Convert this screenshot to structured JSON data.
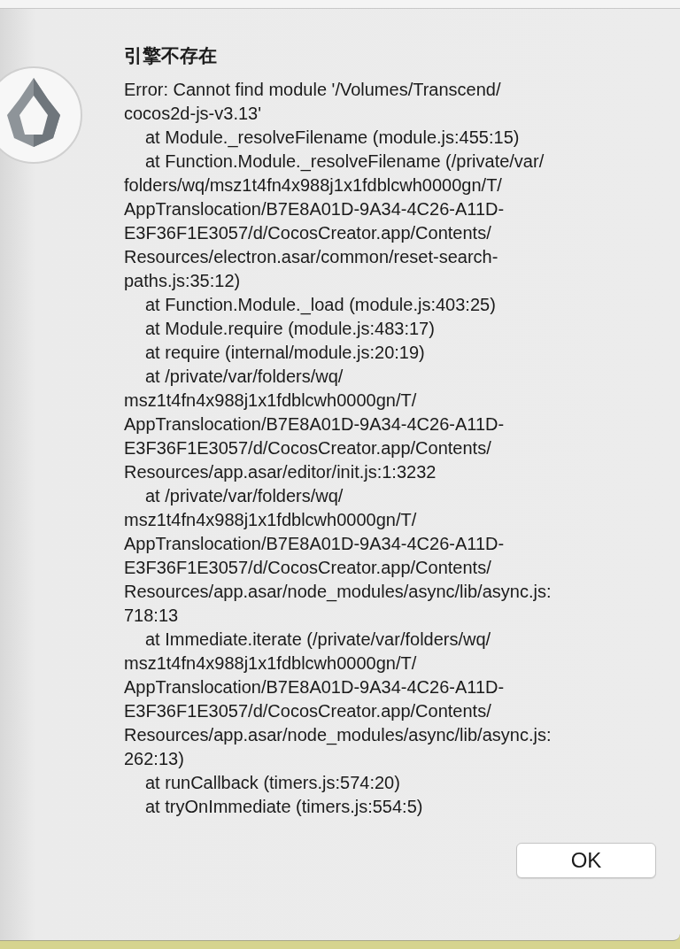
{
  "dialog": {
    "title": "引擎不存在",
    "message": [
      {
        "kind": "text",
        "text": "Error: Cannot find module '/Volumes/Transcend/"
      },
      {
        "kind": "text",
        "text": "cocos2d-js-v3.13'"
      },
      {
        "kind": "call",
        "text": "at Module._resolveFilename (module.js:455:15)"
      },
      {
        "kind": "call",
        "text": "at Function.Module._resolveFilename (/private/var/"
      },
      {
        "kind": "text",
        "text": "folders/wq/msz1t4fn4x988j1x1fdblcwh0000gn/T/"
      },
      {
        "kind": "text",
        "text": "AppTranslocation/B7E8A01D-9A34-4C26-A11D-"
      },
      {
        "kind": "text",
        "text": "E3F36F1E3057/d/CocosCreator.app/Contents/"
      },
      {
        "kind": "text",
        "text": "Resources/electron.asar/common/reset-search-"
      },
      {
        "kind": "text",
        "text": "paths.js:35:12)"
      },
      {
        "kind": "call",
        "text": "at Function.Module._load (module.js:403:25)"
      },
      {
        "kind": "call",
        "text": "at Module.require (module.js:483:17)"
      },
      {
        "kind": "call",
        "text": "at require (internal/module.js:20:19)"
      },
      {
        "kind": "call",
        "text": "at /private/var/folders/wq/"
      },
      {
        "kind": "text",
        "text": "msz1t4fn4x988j1x1fdblcwh0000gn/T/"
      },
      {
        "kind": "text",
        "text": "AppTranslocation/B7E8A01D-9A34-4C26-A11D-"
      },
      {
        "kind": "text",
        "text": "E3F36F1E3057/d/CocosCreator.app/Contents/"
      },
      {
        "kind": "text",
        "text": "Resources/app.asar/editor/init.js:1:3232"
      },
      {
        "kind": "call",
        "text": "at /private/var/folders/wq/"
      },
      {
        "kind": "text",
        "text": "msz1t4fn4x988j1x1fdblcwh0000gn/T/"
      },
      {
        "kind": "text",
        "text": "AppTranslocation/B7E8A01D-9A34-4C26-A11D-"
      },
      {
        "kind": "text",
        "text": "E3F36F1E3057/d/CocosCreator.app/Contents/"
      },
      {
        "kind": "text",
        "text": "Resources/app.asar/node_modules/async/lib/async.js:"
      },
      {
        "kind": "text",
        "text": "718:13"
      },
      {
        "kind": "call",
        "text": "at Immediate.iterate (/private/var/folders/wq/"
      },
      {
        "kind": "text",
        "text": "msz1t4fn4x988j1x1fdblcwh0000gn/T/"
      },
      {
        "kind": "text",
        "text": "AppTranslocation/B7E8A01D-9A34-4C26-A11D-"
      },
      {
        "kind": "text",
        "text": "E3F36F1E3057/d/CocosCreator.app/Contents/"
      },
      {
        "kind": "text",
        "text": "Resources/app.asar/node_modules/async/lib/async.js:"
      },
      {
        "kind": "text",
        "text": "262:13)"
      },
      {
        "kind": "call",
        "text": "at runCallback (timers.js:574:20)"
      },
      {
        "kind": "call",
        "text": "at tryOnImmediate (timers.js:554:5)"
      }
    ],
    "buttons": [
      {
        "label": "OK"
      }
    ]
  }
}
